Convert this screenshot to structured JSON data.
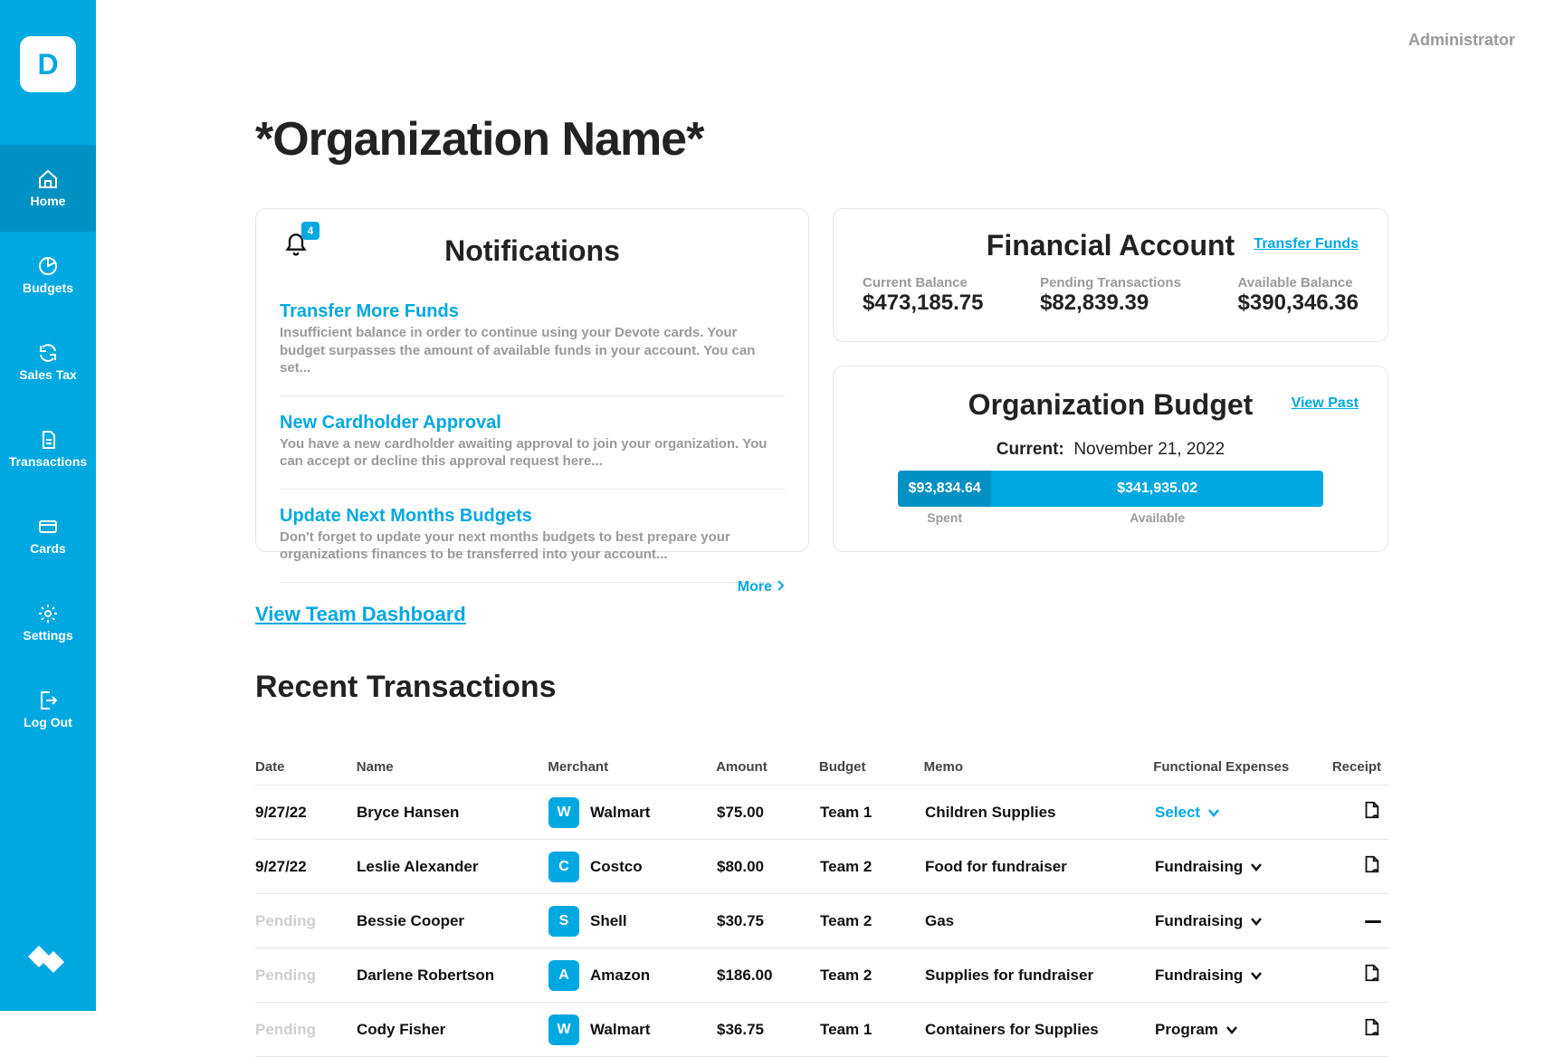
{
  "header": {
    "admin_label": "Administrator"
  },
  "page": {
    "title": "*Organization Name*"
  },
  "sidebar": {
    "logo_letter": "D",
    "items": [
      {
        "id": "home",
        "label": "Home",
        "active": true
      },
      {
        "id": "budgets",
        "label": "Budgets"
      },
      {
        "id": "salestax",
        "label": "Sales Tax"
      },
      {
        "id": "transactions",
        "label": "Transactions"
      },
      {
        "id": "cards",
        "label": "Cards"
      },
      {
        "id": "settings",
        "label": "Settings"
      },
      {
        "id": "logout",
        "label": "Log Out"
      }
    ]
  },
  "notifications": {
    "title": "Notifications",
    "badge_count": "4",
    "items": [
      {
        "title": "Transfer More Funds",
        "body": "Insufficient balance in order to continue using your Devote cards. Your budget surpasses the amount of available funds in your account. You can set..."
      },
      {
        "title": "New Cardholder Approval",
        "body": "You have a new cardholder awaiting approval to join your organization. You can accept or decline this approval request here..."
      },
      {
        "title": "Update Next Months Budgets",
        "body": "Don't forget to update your next months budgets to best prepare your organizations finances to be transferred into your account..."
      }
    ],
    "more_label": "More"
  },
  "financial": {
    "title": "Financial Account",
    "transfer_label": "Transfer Funds",
    "cols": [
      {
        "label": "Current Balance",
        "value": "$473,185.75"
      },
      {
        "label": "Pending Transactions",
        "value": "$82,839.39"
      },
      {
        "label": "Available Balance",
        "value": "$390,346.36"
      }
    ]
  },
  "budget": {
    "title": "Organization Budget",
    "view_past_label": "View Past",
    "current_label": "Current:",
    "current_value": "November 21, 2022",
    "spent": {
      "value": "$93,834.64",
      "label": "Spent"
    },
    "available": {
      "value": "$341,935.02",
      "label": "Available"
    }
  },
  "team_dashboard_link": "View Team Dashboard",
  "transactions": {
    "title": "Recent Transactions",
    "columns": {
      "date": "Date",
      "name": "Name",
      "merchant": "Merchant",
      "amount": "Amount",
      "budget": "Budget",
      "memo": "Memo",
      "functional": "Functional Expenses",
      "receipt": "Receipt"
    },
    "rows": [
      {
        "date": "9/27/22",
        "pending": false,
        "name": "Bryce Hansen",
        "merchant_initial": "W",
        "merchant": "Walmart",
        "amount": "$75.00",
        "budget": "Team 1",
        "memo": "Children Supplies",
        "functional": "Select",
        "functional_select": true,
        "receipt": "receipt"
      },
      {
        "date": "9/27/22",
        "pending": false,
        "name": "Leslie Alexander",
        "merchant_initial": "C",
        "merchant": "Costco",
        "amount": "$80.00",
        "budget": "Team 2",
        "memo": "Food for fundraiser",
        "functional": "Fundraising",
        "functional_select": false,
        "receipt": "receipt"
      },
      {
        "date": "Pending",
        "pending": true,
        "name": "Bessie Cooper",
        "merchant_initial": "S",
        "merchant": "Shell",
        "amount": "$30.75",
        "budget": "Team 2",
        "memo": "Gas",
        "functional": "Fundraising",
        "functional_select": false,
        "receipt": "none"
      },
      {
        "date": "Pending",
        "pending": true,
        "name": "Darlene Robertson",
        "merchant_initial": "A",
        "merchant": "Amazon",
        "amount": "$186.00",
        "budget": "Team 2",
        "memo": "Supplies for fundraiser",
        "functional": "Fundraising",
        "functional_select": false,
        "receipt": "receipt"
      },
      {
        "date": "Pending",
        "pending": true,
        "name": "Cody Fisher",
        "merchant_initial": "W",
        "merchant": "Walmart",
        "amount": "$36.75",
        "budget": "Team 1",
        "memo": "Containers for Supplies",
        "functional": "Program",
        "functional_select": false,
        "receipt": "receipt"
      }
    ]
  },
  "chart_data": {
    "type": "bar",
    "title": "Organization Budget",
    "categories": [
      "Spent",
      "Available"
    ],
    "values": [
      93834.64,
      341935.02
    ]
  }
}
